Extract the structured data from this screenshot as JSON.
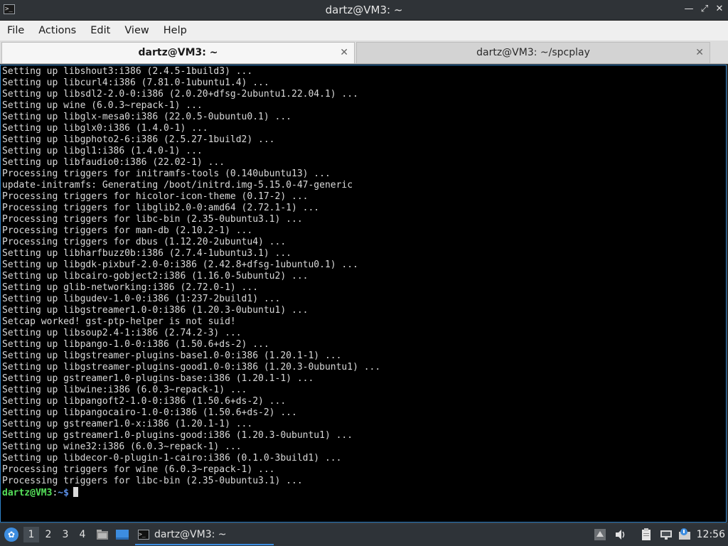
{
  "window": {
    "title": "dartz@VM3: ~",
    "app_icon": "terminal-icon"
  },
  "menu": [
    "File",
    "Actions",
    "Edit",
    "View",
    "Help"
  ],
  "tabs": [
    {
      "label": "dartz@VM3: ~",
      "active": true
    },
    {
      "label": "dartz@VM3: ~/spcplay",
      "active": false
    }
  ],
  "terminal": {
    "lines": [
      "Setting up libshout3:i386 (2.4.5-1build3) ...",
      "Setting up libcurl4:i386 (7.81.0-1ubuntu1.4) ...",
      "Setting up libsdl2-2.0-0:i386 (2.0.20+dfsg-2ubuntu1.22.04.1) ...",
      "Setting up wine (6.0.3~repack-1) ...",
      "Setting up libglx-mesa0:i386 (22.0.5-0ubuntu0.1) ...",
      "Setting up libglx0:i386 (1.4.0-1) ...",
      "Setting up libgphoto2-6:i386 (2.5.27-1build2) ...",
      "Setting up libgl1:i386 (1.4.0-1) ...",
      "Setting up libfaudio0:i386 (22.02-1) ...",
      "Processing triggers for initramfs-tools (0.140ubuntu13) ...",
      "update-initramfs: Generating /boot/initrd.img-5.15.0-47-generic",
      "Processing triggers for hicolor-icon-theme (0.17-2) ...",
      "Processing triggers for libglib2.0-0:amd64 (2.72.1-1) ...",
      "Processing triggers for libc-bin (2.35-0ubuntu3.1) ...",
      "Processing triggers for man-db (2.10.2-1) ...",
      "Processing triggers for dbus (1.12.20-2ubuntu4) ...",
      "Setting up libharfbuzz0b:i386 (2.7.4-1ubuntu3.1) ...",
      "Setting up libgdk-pixbuf-2.0-0:i386 (2.42.8+dfsg-1ubuntu0.1) ...",
      "Setting up libcairo-gobject2:i386 (1.16.0-5ubuntu2) ...",
      "Setting up glib-networking:i386 (2.72.0-1) ...",
      "Setting up libgudev-1.0-0:i386 (1:237-2build1) ...",
      "Setting up libgstreamer1.0-0:i386 (1.20.3-0ubuntu1) ...",
      "Setcap worked! gst-ptp-helper is not suid!",
      "Setting up libsoup2.4-1:i386 (2.74.2-3) ...",
      "Setting up libpango-1.0-0:i386 (1.50.6+ds-2) ...",
      "Setting up libgstreamer-plugins-base1.0-0:i386 (1.20.1-1) ...",
      "Setting up libgstreamer-plugins-good1.0-0:i386 (1.20.3-0ubuntu1) ...",
      "Setting up gstreamer1.0-plugins-base:i386 (1.20.1-1) ...",
      "Setting up libwine:i386 (6.0.3~repack-1) ...",
      "Setting up libpangoft2-1.0-0:i386 (1.50.6+ds-2) ...",
      "Setting up libpangocairo-1.0-0:i386 (1.50.6+ds-2) ...",
      "Setting up gstreamer1.0-x:i386 (1.20.1-1) ...",
      "Setting up gstreamer1.0-plugins-good:i386 (1.20.3-0ubuntu1) ...",
      "Setting up wine32:i386 (6.0.3~repack-1) ...",
      "Setting up libdecor-0-plugin-1-cairo:i386 (0.1.0-3build1) ...",
      "Processing triggers for wine (6.0.3~repack-1) ...",
      "Processing triggers for libc-bin (2.35-0ubuntu3.1) ..."
    ],
    "prompt": {
      "user_host": "dartz@VM3",
      "separator": ":",
      "path": "~$"
    }
  },
  "taskbar": {
    "workspaces": [
      "1",
      "2",
      "3",
      "4"
    ],
    "active_workspace": "1",
    "task_label": "dartz@VM3: ~",
    "clock": "12:56"
  },
  "colors": {
    "prompt_user": "#55e05a",
    "prompt_path": "#5b8fe8",
    "focus_border": "#2f82c9",
    "terminal_bg": "#000000"
  }
}
